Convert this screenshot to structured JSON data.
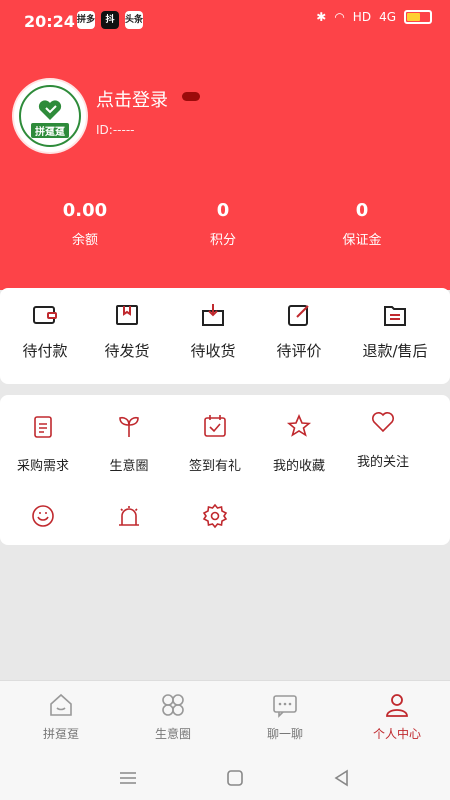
{
  "status_bar": {
    "time": "20:24",
    "app_icons": [
      "拼多",
      "抖",
      "头条"
    ],
    "network": "HD",
    "signal": "4G"
  },
  "profile": {
    "avatar_text": "拼趸趸",
    "login_text": "点击登录",
    "user_id": "ID:-----"
  },
  "stats": [
    {
      "value": "0.00",
      "label": "余额"
    },
    {
      "value": "0",
      "label": "积分"
    },
    {
      "value": "0",
      "label": "保证金"
    }
  ],
  "orders": [
    {
      "label": "待付款",
      "icon": "wallet-icon"
    },
    {
      "label": "待发货",
      "icon": "package-icon"
    },
    {
      "label": "待收货",
      "icon": "receive-box-icon"
    },
    {
      "label": "待评价",
      "icon": "edit-icon"
    },
    {
      "label": "退款/售后",
      "icon": "refund-icon"
    }
  ],
  "tools": [
    {
      "label": "采购需求",
      "icon": "clipboard-icon"
    },
    {
      "label": "生意圈",
      "icon": "sprout-icon"
    },
    {
      "label": "签到有礼",
      "icon": "calendar-check-icon"
    },
    {
      "label": "我的收藏",
      "icon": "star-icon"
    },
    {
      "label": "我的关注",
      "icon": "heart-icon"
    },
    {
      "label": "",
      "icon": "customer-service-icon"
    },
    {
      "label": "",
      "icon": "alarm-icon"
    },
    {
      "label": "",
      "icon": "settings-icon"
    }
  ],
  "tabs": [
    {
      "label": "拼趸趸",
      "icon": "home-icon"
    },
    {
      "label": "生意圈",
      "icon": "circle-icon"
    },
    {
      "label": "聊一聊",
      "icon": "chat-icon"
    },
    {
      "label": "个人中心",
      "icon": "person-icon",
      "active": true
    }
  ],
  "colors": {
    "header": "#fd4348",
    "accent": "#c0292e",
    "brand_green": "#2e8b3a"
  }
}
